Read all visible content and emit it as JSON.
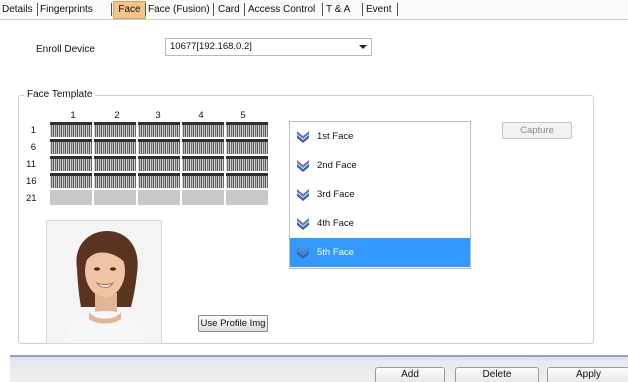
{
  "tabs": [
    {
      "label": "Details"
    },
    {
      "label": "Fingerprints"
    },
    {
      "label": "Face"
    },
    {
      "label": "Face (Fusion)"
    },
    {
      "label": "Card"
    },
    {
      "label": "Access Control"
    },
    {
      "label": "T & A"
    },
    {
      "label": "Event"
    }
  ],
  "active_tab": "Face",
  "enroll": {
    "label": "Enroll Device",
    "value": "10677[192.168.0.2]"
  },
  "template": {
    "title": "Face Template",
    "columns": [
      "1",
      "2",
      "3",
      "4",
      "5"
    ],
    "rows": [
      "1",
      "6",
      "11",
      "16",
      "21"
    ],
    "filled_rows": 4,
    "total_rows": 5
  },
  "faces": {
    "items": [
      {
        "label": "1st Face"
      },
      {
        "label": "2nd Face"
      },
      {
        "label": "3rd Face"
      },
      {
        "label": "4th Face"
      },
      {
        "label": "5th Face"
      }
    ],
    "selected": "5th Face"
  },
  "buttons": {
    "capture": "Capture",
    "use_profile": "Use Profile Img",
    "add": "Add",
    "delete": "Delete",
    "apply": "Apply"
  },
  "colors": {
    "active_tab": "#f7c488",
    "selection": "#3399ff",
    "accent_bar": "#8fa3c7"
  }
}
